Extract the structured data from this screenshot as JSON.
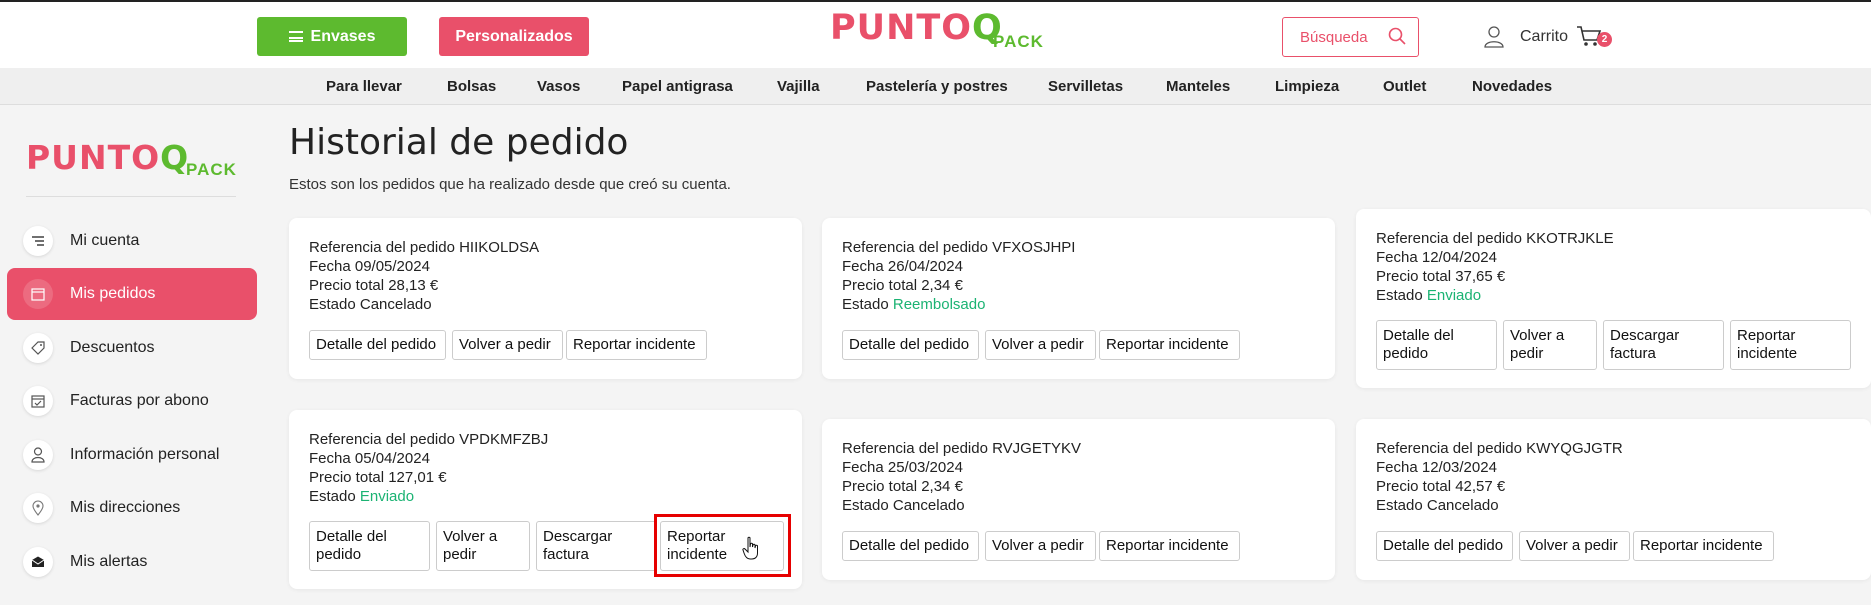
{
  "header": {
    "envases_label": "Envases",
    "personalizados_label": "Personalizados",
    "logo_text": "PUNTO",
    "logo_q": "Q",
    "logo_pack": "PACK",
    "search_placeholder": "Búsqueda",
    "cart_label": "Carrito",
    "cart_count": "2"
  },
  "categories": [
    "Para llevar",
    "Bolsas",
    "Vasos",
    "Papel antigrasa",
    "Vajilla",
    "Pastelería y postres",
    "Servilletas",
    "Manteles",
    "Limpieza",
    "Outlet",
    "Novedades"
  ],
  "sidebar": {
    "logo_text": "PUNTO",
    "logo_q": "Q",
    "logo_pack": "PACK",
    "items": [
      {
        "label": "Mi cuenta",
        "icon": "list-icon"
      },
      {
        "label": "Mis pedidos",
        "icon": "calendar-icon",
        "active": true
      },
      {
        "label": "Descuentos",
        "icon": "tag-icon"
      },
      {
        "label": "Facturas por abono",
        "icon": "calendar-check-icon"
      },
      {
        "label": "Información personal",
        "icon": "user-icon"
      },
      {
        "label": "Mis direcciones",
        "icon": "location-pin-icon"
      },
      {
        "label": "Mis alertas",
        "icon": "envelope-icon"
      }
    ]
  },
  "main": {
    "title": "Historial de pedido",
    "subtitle": "Estos son los pedidos que ha realizado desde que creó su cuenta."
  },
  "orders": [
    {
      "ref": "Referencia del pedido HIIKOLDSA",
      "date": "Fecha 09/05/2024",
      "total": "Precio total 28,13 €",
      "state_prefix": "Estado",
      "state": "Cancelado",
      "buttons": [
        "Detalle del pedido",
        "Volver a pedir",
        "Reportar incidente"
      ]
    },
    {
      "ref": "Referencia del pedido VFXOSJHPI",
      "date": "Fecha 26/04/2024",
      "total": "Precio total 2,34 €",
      "state_prefix": "Estado",
      "state": "Reembolsado",
      "buttons": [
        "Detalle del pedido",
        "Volver a pedir",
        "Reportar incidente"
      ]
    },
    {
      "ref": "Referencia del pedido KKOTRJKLE",
      "date": "Fecha 12/04/2024",
      "total": "Precio total 37,65 €",
      "state_prefix": "Estado",
      "state": "Enviado",
      "buttons": [
        "Detalle del pedido",
        "Volver a pedir",
        "Descargar factura",
        "Reportar incidente"
      ]
    },
    {
      "ref": "Referencia del pedido VPDKMFZBJ",
      "date": "Fecha 05/04/2024",
      "total": "Precio total 127,01 €",
      "state_prefix": "Estado",
      "state": "Enviado",
      "buttons": [
        "Detalle del pedido",
        "Volver a pedir",
        "Descargar factura",
        "Reportar incidente"
      ]
    },
    {
      "ref": "Referencia del pedido RVJGETYKV",
      "date": "Fecha 25/03/2024",
      "total": "Precio total 2,34 €",
      "state_prefix": "Estado",
      "state": "Cancelado",
      "buttons": [
        "Detalle del pedido",
        "Volver a pedir",
        "Reportar incidente"
      ]
    },
    {
      "ref": "Referencia del pedido KWYQGJGTR",
      "date": "Fecha 12/03/2024",
      "total": "Precio total 42,57 €",
      "state_prefix": "Estado",
      "state": "Cancelado",
      "buttons": [
        "Detalle del pedido",
        "Volver a pedir",
        "Reportar incidente"
      ]
    }
  ],
  "colors": {
    "brand_pink": "#e9506a",
    "brand_green": "#5dba2f",
    "status_green": "#1bb373",
    "highlight_red": "#e60000"
  }
}
